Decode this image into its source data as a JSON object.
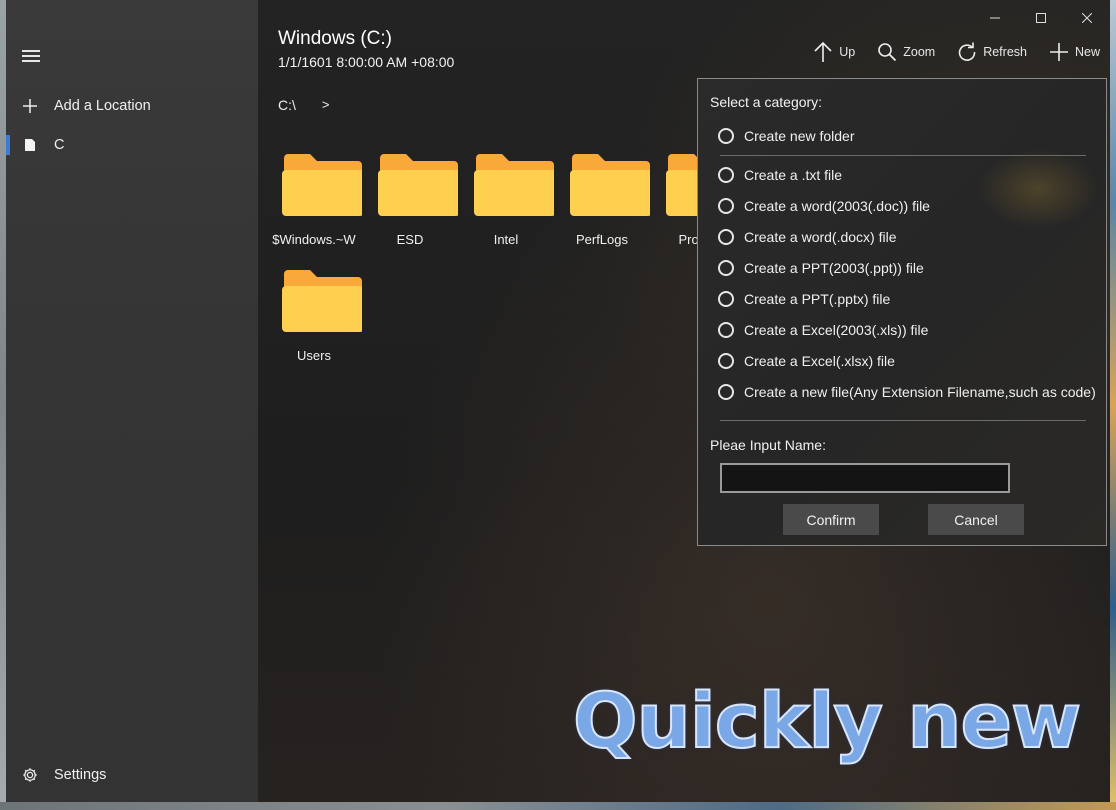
{
  "app": {
    "title": "Windows (C:)",
    "subtitle": "1/1/1601 8:00:00 AM +08:00"
  },
  "sidebar": {
    "menu_icon": "hamburger-icon",
    "add_location": {
      "label": "Add a Location",
      "icon": "plus-icon"
    },
    "items": [
      {
        "label": "C",
        "icon": "drive-icon",
        "selected": true
      }
    ],
    "settings": {
      "label": "Settings",
      "icon": "gear-icon"
    }
  },
  "toolbar": {
    "up": {
      "label": "Up",
      "icon": "arrow-up-icon"
    },
    "zoom": {
      "label": "Zoom",
      "icon": "search-icon"
    },
    "refresh": {
      "label": "Refresh",
      "icon": "refresh-icon"
    },
    "new": {
      "label": "New",
      "icon": "plus-icon"
    }
  },
  "window_controls": [
    "minimize",
    "maximize",
    "close"
  ],
  "breadcrumb": {
    "path": "C:\\",
    "separator": ">"
  },
  "folders": [
    {
      "name": "$Windows.~W"
    },
    {
      "name": "ESD"
    },
    {
      "name": "Intel"
    },
    {
      "name": "PerfLogs"
    },
    {
      "name": "Progra"
    },
    {
      "name": "Users"
    }
  ],
  "new_dialog": {
    "heading": "Select a category:",
    "options": [
      "Create new folder",
      "Create a .txt file",
      "Create a word(2003(.doc)) file",
      "Create a word(.docx) file",
      "Create a PPT(2003(.ppt)) file",
      "Create a PPT(.pptx) file",
      "Create a Excel(2003(.xls)) file",
      "Create a Excel(.xlsx) file",
      "Create a new file(Any Extension Filename,such as code)"
    ],
    "name_label": "Pleae Input Name:",
    "name_value": "",
    "confirm_label": "Confirm",
    "cancel_label": "Cancel"
  },
  "overlay_caption": "Quickly new",
  "colors": {
    "accent": "#3a7bd5",
    "folder_front": "#ffd04f",
    "folder_back": "#f9a83a",
    "caption": "#7aa7e6"
  }
}
